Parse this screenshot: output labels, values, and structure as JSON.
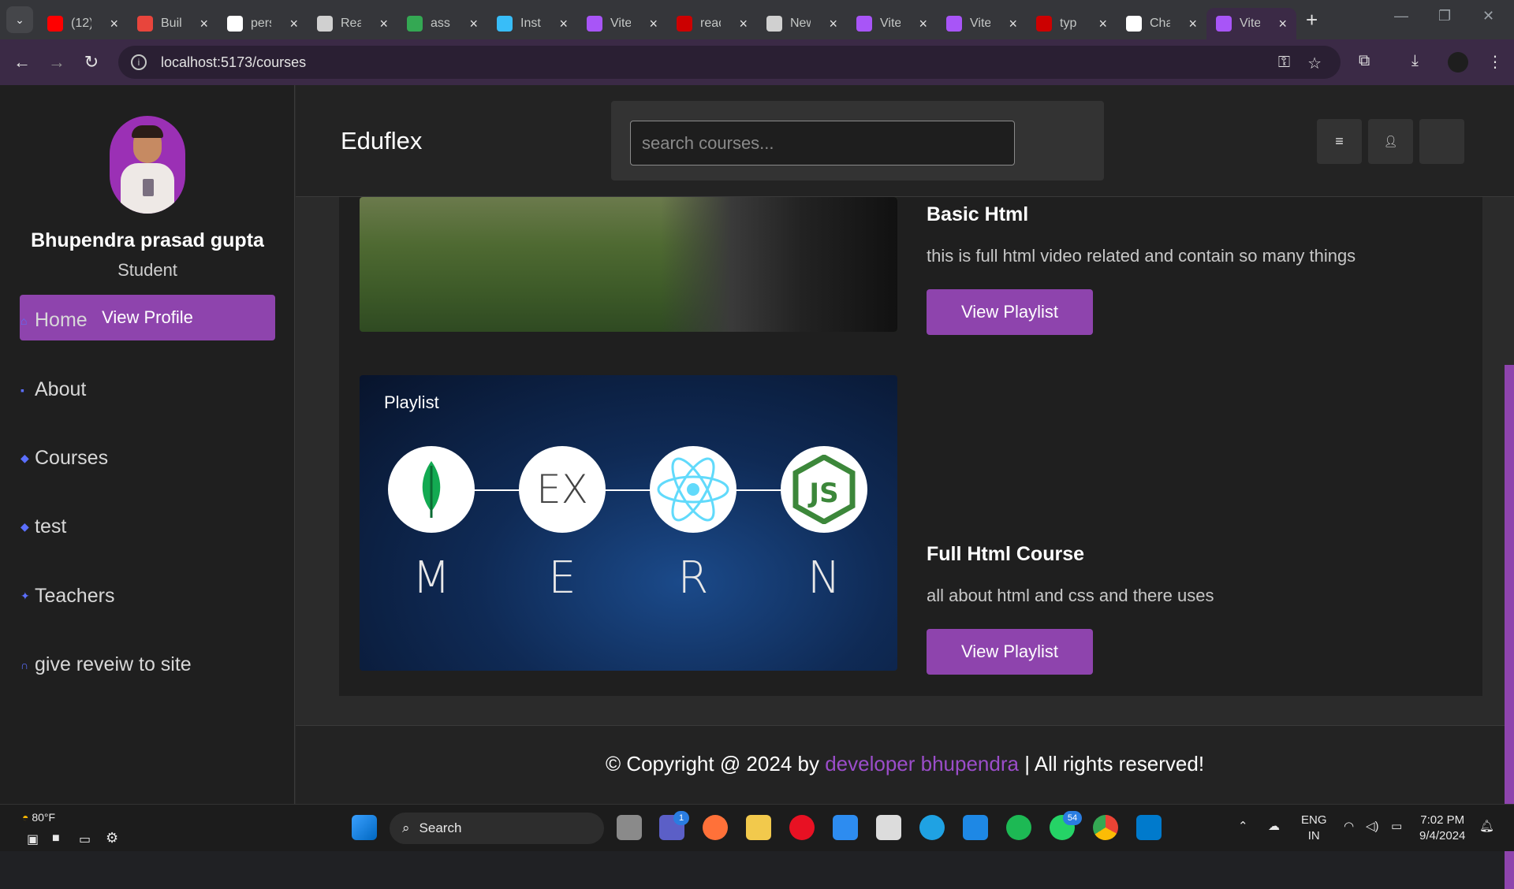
{
  "browser": {
    "tabs": [
      {
        "label": "(12)",
        "color": "#ff0000"
      },
      {
        "label": "Buil",
        "color": "#e8453c"
      },
      {
        "label": "pers",
        "color": "#ffffff"
      },
      {
        "label": "Rea",
        "color": "#d0d0d0"
      },
      {
        "label": "ass",
        "color": "#34a853"
      },
      {
        "label": "Inst",
        "color": "#38bdf8"
      },
      {
        "label": "Vite",
        "color": "#a855f7"
      },
      {
        "label": "reac",
        "color": "#cc0000"
      },
      {
        "label": "New",
        "color": "#d0d0d0"
      },
      {
        "label": "Vite",
        "color": "#a855f7"
      },
      {
        "label": "Vite",
        "color": "#a855f7"
      },
      {
        "label": "typ",
        "color": "#cc0000"
      },
      {
        "label": "Cha",
        "color": "#ffffff"
      },
      {
        "label": "Vite",
        "color": "#a855f7"
      }
    ],
    "url": "localhost:5173/courses"
  },
  "sidebar": {
    "user_name": "Bhupendra prasad gupta",
    "user_role": "Student",
    "view_profile": "View Profile",
    "nav": [
      {
        "label": "Home",
        "icon": "home-icon"
      },
      {
        "label": "About",
        "icon": "chat-icon"
      },
      {
        "label": "Courses",
        "icon": "graduation-cap-icon"
      },
      {
        "label": "test",
        "icon": "graduation-cap-icon"
      },
      {
        "label": "Teachers",
        "icon": "users-icon"
      },
      {
        "label": "give reveiw to site",
        "icon": "headset-icon"
      }
    ]
  },
  "header": {
    "brand": "Eduflex",
    "search_placeholder": "search courses..."
  },
  "courses": [
    {
      "title": "Basic Html",
      "description": "this is full html video related and contain so many things",
      "button": "View Playlist"
    },
    {
      "title": "Full Html Course",
      "description": "all about html and css and there uses",
      "button": "View Playlist",
      "badge": "Playlist",
      "mern_letters": [
        "M",
        "E",
        "R",
        "N"
      ],
      "mern_express": "EX"
    }
  ],
  "footer": {
    "prefix": "© Copyright @ 2024 by",
    "link": "developer bhupendra",
    "suffix": "| All rights reserved!"
  },
  "taskbar": {
    "weather": "80°F",
    "search": "Search",
    "language": "ENG",
    "region": "IN",
    "time": "7:02 PM",
    "date": "9/4/2024",
    "teams_badge": "1",
    "whatsapp_badge": "54"
  },
  "colors": {
    "accent": "#8e44ad",
    "link": "#9b4dca",
    "nav_icon": "#5b6fff"
  }
}
